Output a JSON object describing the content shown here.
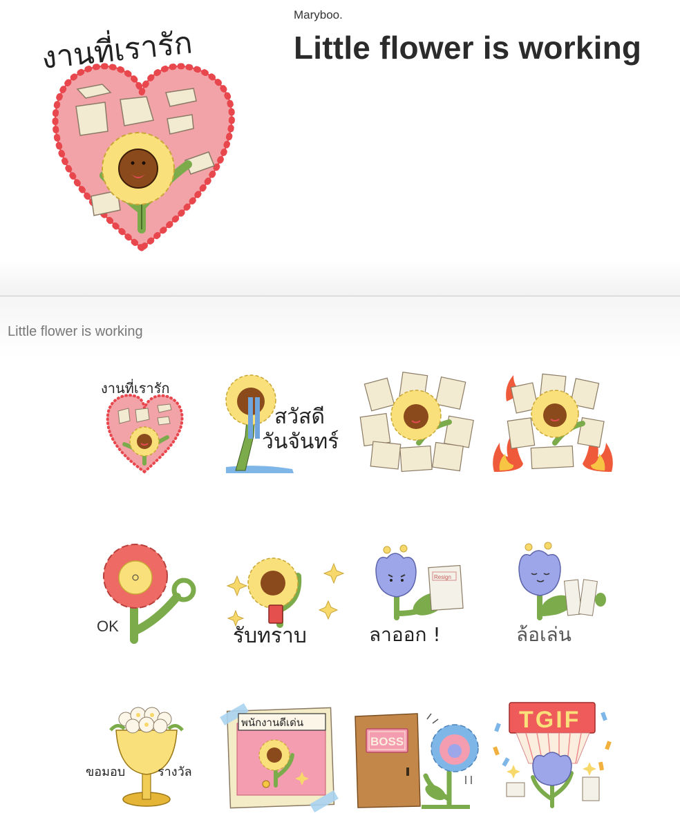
{
  "header": {
    "author": "Maryboo.",
    "title": "Little flower is working",
    "main_sticker_caption": "งานที่เรารัก"
  },
  "section": {
    "label": "Little flower is working"
  },
  "stickers": [
    {
      "name": "sticker-heart-work-love",
      "caption": "งานที่เรารัก"
    },
    {
      "name": "sticker-hello-monday",
      "caption_line1": "สวัสดี",
      "caption_line2": "วันจันทร์"
    },
    {
      "name": "sticker-paper-pile",
      "caption": ""
    },
    {
      "name": "sticker-paper-fire",
      "caption": ""
    },
    {
      "name": "sticker-ok",
      "caption": "OK"
    },
    {
      "name": "sticker-acknowledge",
      "caption": "รับทราบ"
    },
    {
      "name": "sticker-resign",
      "caption": "ลาออก !",
      "paper_text": "Resign"
    },
    {
      "name": "sticker-just-kidding",
      "caption": "ล้อเล่น"
    },
    {
      "name": "sticker-award-trophy",
      "caption_left": "ขอมอบ",
      "caption_right": "รางวัล"
    },
    {
      "name": "sticker-outstanding-employee",
      "caption": "พนักงานดีเด่น"
    },
    {
      "name": "sticker-boss-door",
      "caption": "BOSS"
    },
    {
      "name": "sticker-tgif",
      "caption": "TGIF"
    }
  ],
  "colors": {
    "heart_pink": "#f1a3a8",
    "heart_red": "#e8474d",
    "flower_yellow": "#f9e07b",
    "flower_face": "#8a4a1c",
    "stem_green": "#7cab4c",
    "flower_blue": "#9ea6ea",
    "flower_red": "#ee6a64",
    "title_text": "#2b2b2b"
  }
}
